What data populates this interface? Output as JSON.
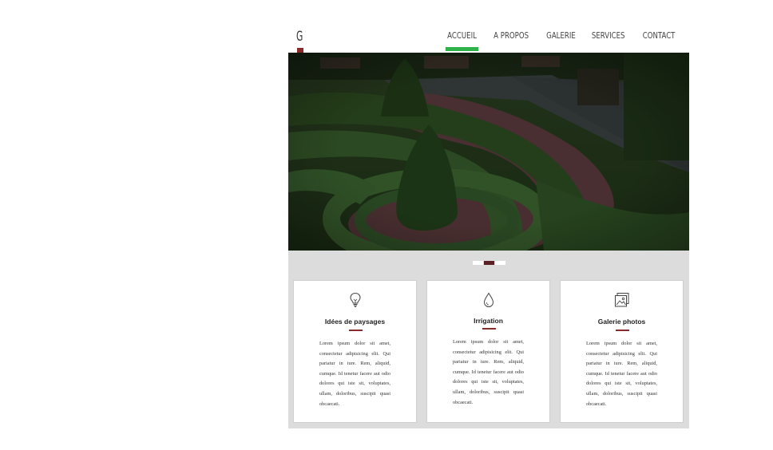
{
  "header": {
    "logo": "G",
    "nav": [
      "ACCUEIL",
      "A PROPOS",
      "GALERIE",
      "SERVICES",
      "CONTACT"
    ],
    "active_nav": "ACCUEIL",
    "active_color": "#2fb24a",
    "accent_color": "#8a2b2b"
  },
  "hero": {
    "image": "dark formal boxwood garden with topiary cones and benches",
    "slider_dots": 3,
    "active_dot": 2
  },
  "cards": [
    {
      "icon": "lightbulb-icon",
      "title": "Idées de paysages",
      "text": "Lorem ipsum dolor sit amet, consectetur adipisicing elit. Qui pariatur in iure. Rem, aliquid, cumque. Id tenetur facere aut odio dolores qui iste sit, voluptates, ullam, doloribus, suscipit quasi obcaecati."
    },
    {
      "icon": "water-drop-icon",
      "title": "Irrigation",
      "text": "Lorem ipsum dolor sit amet, consectetur adipisicing elit. Qui pariatur in iure. Rem, aliquid, cumque. Id tenetur facere aut odio dolores qui iste sit, voluptates, ullam, doloribus, suscipit quasi obcaecati."
    },
    {
      "icon": "photo-gallery-icon",
      "title": "Galerie photos",
      "text": "Lorem ipsum dolor sit amet, consectetur adipisicing elit. Qui pariatur in iure. Rem, aliquid, cumque. Id tenetur facere aut odio dolores qui iste sit, voluptates, ullam, doloribus, suscipit quasi obcaecati."
    }
  ]
}
